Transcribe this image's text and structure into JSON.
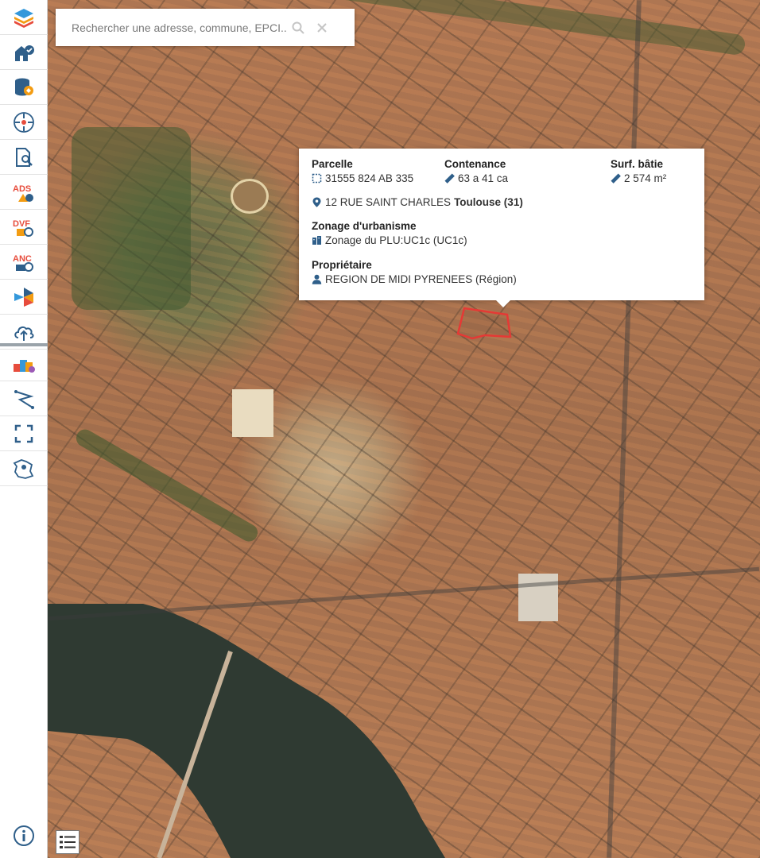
{
  "search": {
    "placeholder": "Rechercher une adresse, commune, EPCI..."
  },
  "toolbar": {
    "tools": [
      "layers-icon",
      "buildings-icon",
      "database-icon",
      "compass-icon",
      "search-parcel-icon",
      "ads-icon",
      "dvf-icon",
      "anc-icon",
      "share-icon",
      "upload-cloud-icon",
      "shapes-icon",
      "measure-icon",
      "fullscreen-icon",
      "france-map-icon",
      "info-icon"
    ],
    "ads_label": "ADS",
    "dvf_label": "DVF",
    "anc_label": "ANC"
  },
  "popup": {
    "parcelle_title": "Parcelle",
    "parcelle_value": "31555 824 AB 335",
    "contenance_title": "Contenance",
    "contenance_value": "63 a 41 ca",
    "surf_title": "Surf. bâtie",
    "surf_value": "2 574 m²",
    "address": "12 RUE SAINT CHARLES",
    "city": "Toulouse (31)",
    "zonage_title": "Zonage d'urbanisme",
    "zonage_value": "Zonage du PLU:UC1c (UC1c)",
    "proprietaire_title": "Propriétaire",
    "proprietaire_value": "REGION DE MIDI PYRENEES (Région)"
  },
  "colors": {
    "accent": "#2f5f8a",
    "parcel": "#e53935",
    "ads": "#e74c3c",
    "dvf": "#e74c3c",
    "anc": "#e74c3c"
  }
}
